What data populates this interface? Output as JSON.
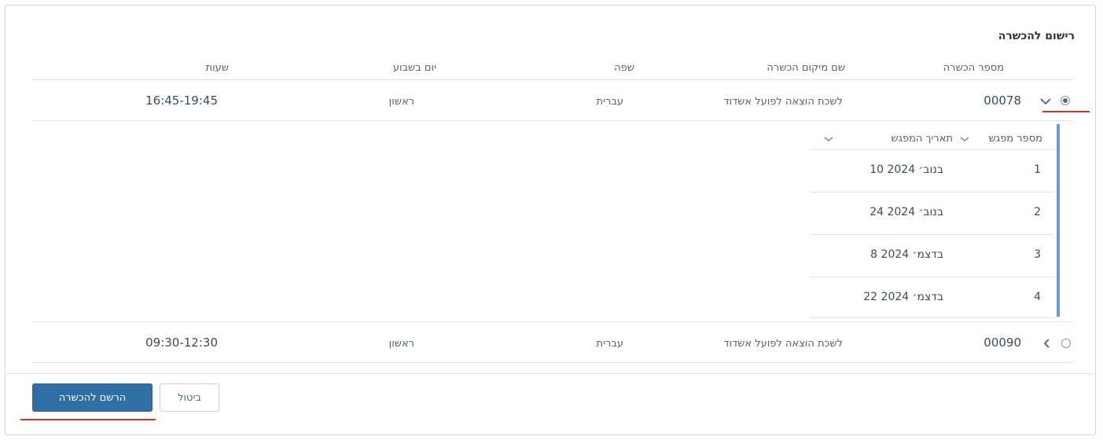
{
  "section": {
    "title": "רישום להכשרה"
  },
  "table": {
    "headers": {
      "training_number": "מספר הכשרה",
      "location": "שם מיקום הכשרה",
      "language": "שפה",
      "weekday": "יום בשבוע",
      "hours": "שעות"
    },
    "rows": [
      {
        "selected": true,
        "expanded": true,
        "training_number": "00078",
        "location": "לשכת הוצאה לפועל אשדוד",
        "language": "עברית",
        "weekday": "ראשון",
        "hours": "16:45-19:45"
      },
      {
        "selected": false,
        "expanded": false,
        "training_number": "00090",
        "location": "לשכת הוצאה לפועל אשדוד",
        "language": "עברית",
        "weekday": "ראשון",
        "hours": "09:30-12:30"
      }
    ]
  },
  "sessions": {
    "headers": {
      "meeting_number": "מספר מפגש",
      "meeting_date": "תאריך המפגש"
    },
    "rows": [
      {
        "number": "1",
        "date": "10 בנוב׳ 2024"
      },
      {
        "number": "2",
        "date": "24 בנוב׳ 2024"
      },
      {
        "number": "3",
        "date": "8 בדצמ׳ 2024"
      },
      {
        "number": "4",
        "date": "22 בדצמ׳ 2024"
      }
    ]
  },
  "actions": {
    "register_label": "הרשם להכשרה",
    "cancel_label": "ביטול"
  },
  "colors": {
    "primary": "#2f6fa3",
    "highlight_underline": "#d43030",
    "subtable_bar": "#6d9ac6"
  },
  "icons": {
    "expand": "chevron-down-icon",
    "collapsed": "chevron-left-icon",
    "sort": "chevron-down-icon"
  }
}
